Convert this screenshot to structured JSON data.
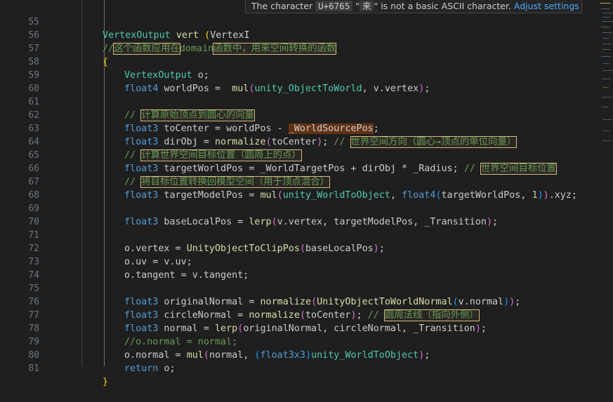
{
  "editor": {
    "lines": [
      {
        "n": "55"
      },
      {
        "n": "56"
      },
      {
        "n": "57"
      },
      {
        "n": "58"
      },
      {
        "n": "59"
      },
      {
        "n": "60"
      },
      {
        "n": "61"
      },
      {
        "n": "62"
      },
      {
        "n": "63"
      },
      {
        "n": "64"
      },
      {
        "n": "65"
      },
      {
        "n": "66"
      },
      {
        "n": "67"
      },
      {
        "n": "68"
      },
      {
        "n": "69"
      },
      {
        "n": "70"
      },
      {
        "n": "71"
      },
      {
        "n": "72"
      },
      {
        "n": "73"
      },
      {
        "n": "74"
      },
      {
        "n": "75"
      },
      {
        "n": "76"
      },
      {
        "n": "77"
      },
      {
        "n": "78"
      },
      {
        "n": "79"
      },
      {
        "n": "80"
      },
      {
        "n": "81"
      }
    ],
    "code": {
      "l55": {
        "type": "VertexOutput",
        "fn": "vert",
        "paren": "(",
        "trail": "VertexI"
      },
      "l56": {
        "slashes": "//",
        "c1": "这个函数应用在",
        "c2": "domain",
        "c3": "函数中，用来空间转换的函数"
      },
      "l57": {
        "brace": "{"
      },
      "l58": {
        "type": "VertexOutput",
        "rest": " o;"
      },
      "l59": {
        "type": "float4",
        "var": " worldPos = ",
        "fn": "mul",
        "p1": "(",
        "arg1": "unity_ObjectToWorld",
        "mid": ", v.vertex",
        "p2": ")",
        "end": ";"
      },
      "l61": {
        "slashes": "// ",
        "text": "计算原始顶点到圆心的向量"
      },
      "l62": {
        "type": "float3",
        "pre": " toCenter = worldPos - ",
        "hl": "_WorldSourcePos",
        "end": ";"
      },
      "l63": {
        "type": "float3",
        "pre": " dirObj = ",
        "fn": "normalize",
        "p1": "(",
        "arg": "toCenter",
        "p2": ")",
        "end": ";",
        "cslash": " // ",
        "ctext": "世界空间方向（圆心→顶点的单位向量）"
      },
      "l64": {
        "slashes": "// ",
        "text": "计算世界空间目标位置（圆周上的点）"
      },
      "l65": {
        "type": "float3",
        "pre": " targetWorldPos = _WorldTargetPos + dirObj * _Radius;",
        "cslash": " // ",
        "ctext": "世界空间目标位置"
      },
      "l66": {
        "slashes": "// ",
        "text": "将目标位置转换回模型空间（用于顶点混合）"
      },
      "l67": {
        "type": "float3",
        "pre": " targetModelPos = ",
        "fn": "mul",
        "p1": "(",
        "arg1": "unity_WorldToObject",
        "comma": ", ",
        "type2": "float4",
        "p2": "(",
        "inner": "targetWorldPos, ",
        "num": "1",
        "p3": ")",
        "p4": ")",
        "end": ".xyz;"
      },
      "l69": {
        "type": "float3",
        "pre": " baseLocalPos = ",
        "fn": "lerp",
        "p1": "(",
        "args": "v.vertex, targetModelPos, _Transition",
        "p2": ")",
        "end": ";"
      },
      "l71": {
        "pre": "o.vertex = ",
        "fn": "UnityObjectToClipPos",
        "p1": "(",
        "args": "baseLocalPos",
        "p2": ")",
        "end": ";"
      },
      "l72": {
        "text": "o.uv = v.uv;"
      },
      "l73": {
        "text": "o.tangent = v.tangent;"
      },
      "l75": {
        "type": "float3",
        "pre": " originalNormal = ",
        "fn": "normalize",
        "p1": "(",
        "fn2": "UnityObjectToWorldNormal",
        "p2": "(",
        "args": "v.normal",
        "p3": ")",
        "p4": ")",
        "end": ";"
      },
      "l76": {
        "type": "float3",
        "pre": " circleNormal = ",
        "fn": "normalize",
        "p1": "(",
        "arg": "toCenter",
        "p2": ")",
        "end": ";",
        "cslash": " // ",
        "ctext": "圆周法线（指向外侧）"
      },
      "l77": {
        "type": "float3",
        "pre": " normal = ",
        "fn": "lerp",
        "p1": "(",
        "args": "originalNormal, circleNormal, _Transition",
        "p2": ")",
        "end": ";"
      },
      "l78": {
        "text": "//o.normal = normal;"
      },
      "l79": {
        "pre": "o.normal = ",
        "fn": "mul",
        "p1": "(",
        "args": "normal, ",
        "p2": "(",
        "type": "float3x3",
        "p3": ")",
        "arg2": "unity_WorldToObject",
        "p4": ")",
        "end": ";"
      },
      "l80": {
        "kw": "return",
        "rest": " o;"
      },
      "l81": {
        "brace": "}"
      }
    }
  },
  "tooltip": {
    "pre": "The character ",
    "code": "U+6765",
    "quote_open": " \"",
    "char": "来",
    "quote_close": "\" ",
    "msg": "is not a basic ASCII character. ",
    "link": "Adjust settings"
  },
  "colors": {
    "background": "#1f1f1f",
    "keyword": "#569cd6",
    "type": "#4ec9b0",
    "function": "#dcdcaa",
    "comment": "#6a9955",
    "warning_highlight": "#d7ba7d"
  }
}
